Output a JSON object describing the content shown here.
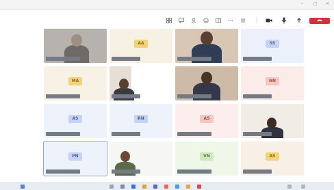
{
  "window": {
    "title": "",
    "controls": [
      "–",
      "□",
      "✕"
    ]
  },
  "toolbar": {
    "left_text": "",
    "icons": [
      "grid-icon",
      "chat-icon",
      "people-icon",
      "reactions-icon",
      "view-icon",
      "more-icon",
      "camera-icon",
      "mic-icon",
      "share-icon",
      "phone-icon"
    ],
    "leave_label": ""
  },
  "colors": {
    "leave": "#d92f3a",
    "badge_yellow": "#f3d27a",
    "badge_blue": "#c6d4f3",
    "badge_green": "#cfe6bf",
    "badge_pink": "#f2c8c2"
  },
  "tiles": [
    {
      "kind": "video",
      "initials": "",
      "name": "",
      "bg": "#b7b2ad"
    },
    {
      "kind": "initials",
      "initials": "AA",
      "name": "",
      "bg": "#f7f1e4",
      "badge": "#f3d27a",
      "badge_text": "#8a6a1f"
    },
    {
      "kind": "video",
      "initials": "",
      "name": "",
      "bg": "#d8c7b5"
    },
    {
      "kind": "initials",
      "initials": "SS",
      "name": "",
      "bg": "#ebf0fa",
      "badge": "#c6d4f3",
      "badge_text": "#4d5f8f"
    },
    {
      "kind": "initials",
      "initials": "MA",
      "name": "",
      "bg": "#f8f1e6",
      "badge": "#f3d27a",
      "badge_text": "#8a6a1f"
    },
    {
      "kind": "video",
      "initials": "",
      "name": "",
      "bg": "#ffffff"
    },
    {
      "kind": "video",
      "initials": "",
      "name": "",
      "bg": "#cdbba8"
    },
    {
      "kind": "initials",
      "initials": "NN",
      "name": "",
      "bg": "#fbecea",
      "badge": "#f2c8c2",
      "badge_text": "#a0503f"
    },
    {
      "kind": "initials",
      "initials": "AS",
      "name": "",
      "bg": "#eef3fb",
      "badge": "#c6d4f3",
      "badge_text": "#4d5f8f"
    },
    {
      "kind": "initials",
      "initials": "RN",
      "name": "",
      "bg": "#eef3fb",
      "badge": "#c6d4f3",
      "badge_text": "#4d5f8f"
    },
    {
      "kind": "initials",
      "initials": "AS",
      "name": "",
      "bg": "#fbeeec",
      "badge": "#f2c8c2",
      "badge_text": "#a0503f"
    },
    {
      "kind": "video",
      "initials": "",
      "name": "",
      "bg": "#f2ece6"
    },
    {
      "kind": "initials",
      "initials": "PN",
      "name": "",
      "bg": "#eef3fb",
      "badge": "#c6d4f3",
      "badge_text": "#4d5f8f"
    },
    {
      "kind": "video",
      "initials": "",
      "name": "",
      "bg": "#f6f6f4"
    },
    {
      "kind": "initials",
      "initials": "VN",
      "name": "",
      "bg": "#eef7e8",
      "badge": "#cfe6bf",
      "badge_text": "#4f7a3c"
    },
    {
      "kind": "initials",
      "initials": "AS",
      "name": "",
      "bg": "#f8f0e6",
      "badge": "#f3d27a",
      "badge_text": "#8a6a1f"
    }
  ]
}
